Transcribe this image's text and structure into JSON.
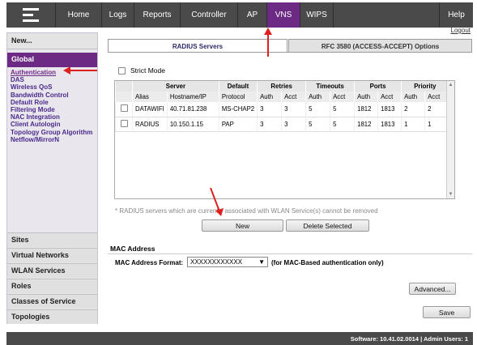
{
  "nav": {
    "items": [
      {
        "label": "Home"
      },
      {
        "label": "Logs"
      },
      {
        "label": "Reports"
      },
      {
        "label": "Controller"
      },
      {
        "label": "AP"
      },
      {
        "label": "VNS"
      },
      {
        "label": "WIPS"
      }
    ],
    "help": "Help",
    "active": "VNS",
    "active_color": "#6d2a84",
    "logo_icon": "extreme-logo-icon"
  },
  "logout": "Logout",
  "sidebar": {
    "new_label": "New...",
    "global_label": "Global",
    "links": [
      "Authentication",
      "DAS",
      "Wireless QoS",
      "Bandwidth Control",
      "Default Role",
      "Filtering Mode",
      "NAC Integration",
      "Client Autologin",
      "Topology Group Algorithm",
      "Netflow/MirrorN"
    ],
    "current_link": "Authentication",
    "sections": [
      "Sites",
      "Virtual Networks",
      "WLAN Services",
      "Roles",
      "Classes of Service",
      "Topologies"
    ]
  },
  "tabs": {
    "active": "RADIUS Servers",
    "inactive": "RFC 3580 (ACCESS-ACCEPT) Options"
  },
  "strict_mode_label": "Strict Mode",
  "table": {
    "group_headers": [
      "Server",
      "Default",
      "Retries",
      "Timeouts",
      "Ports",
      "Priority"
    ],
    "sub_headers": [
      "Alias",
      "Hostname/IP",
      "Protocol",
      "Auth",
      "Acct",
      "Auth",
      "Acct",
      "Auth",
      "Acct",
      "Auth",
      "Acct"
    ],
    "rows": [
      [
        "DATAWIFI",
        "40.71.81.238",
        "MS-CHAP2",
        "3",
        "3",
        "5",
        "5",
        "1812",
        "1813",
        "2",
        "2"
      ],
      [
        "RADIUS",
        "10.150.1.15",
        "PAP",
        "3",
        "3",
        "5",
        "5",
        "1812",
        "1813",
        "1",
        "1"
      ]
    ]
  },
  "note": "* RADIUS servers which are currently associated with WLAN Service(s) cannot be removed",
  "buttons": {
    "new": "New",
    "delete": "Delete Selected",
    "advanced": "Advanced...",
    "save": "Save"
  },
  "mac": {
    "header": "MAC Address",
    "format_label": "MAC Address Format:",
    "format_value": "XXXXXXXXXXXX",
    "hint": "(for MAC-Based authentication only)"
  },
  "footer": "Software: 10.41.02.0014 | Admin Users: 1",
  "annotation_color": "#e02020"
}
